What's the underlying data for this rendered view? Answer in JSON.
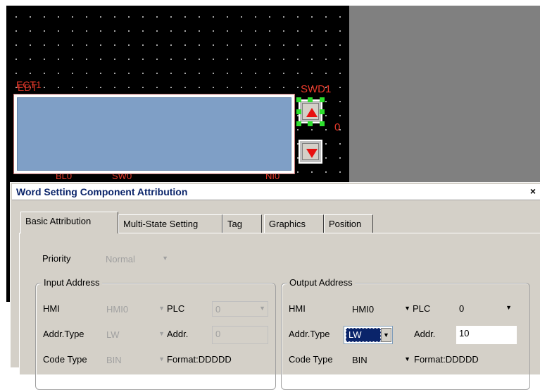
{
  "canvas": {
    "labels": {
      "edit": "ECT1",
      "edit_overlap": "EDT",
      "switch": "SWD1",
      "digit": "0",
      "bottom_1": "BL0",
      "bottom_2": "SW0",
      "bottom_3": "NI0"
    }
  },
  "dialog": {
    "title": "Word Setting Component Attribution",
    "close": "×",
    "tabs": [
      "Basic Attribution",
      "Multi-State Setting",
      "Tag",
      "Graphics",
      "Position"
    ],
    "priority": {
      "label": "Priority",
      "value": "Normal"
    },
    "input_address": {
      "title": "Input Address",
      "hmi_label": "HMI",
      "hmi_value": "HMI0",
      "plc_label": "PLC",
      "plc_value": "0",
      "addr_type_label": "Addr.Type",
      "addr_type_value": "LW",
      "addr_label": "Addr.",
      "addr_value": "0",
      "code_type_label": "Code Type",
      "code_type_value": "BIN",
      "format": "Format:DDDDD"
    },
    "output_address": {
      "title": "Output Address",
      "hmi_label": "HMI",
      "hmi_value": "HMI0",
      "plc_label": "PLC",
      "plc_value": "0",
      "addr_type_label": "Addr.Type",
      "addr_type_value": "LW",
      "addr_label": "Addr.",
      "addr_value": "10",
      "code_type_label": "Code Type",
      "code_type_value": "BIN",
      "format": "Format:DDDDD"
    }
  },
  "colors": {
    "selection": "#0a246a",
    "accent_red": "#e8392a",
    "handle_green": "#2ee02e"
  }
}
